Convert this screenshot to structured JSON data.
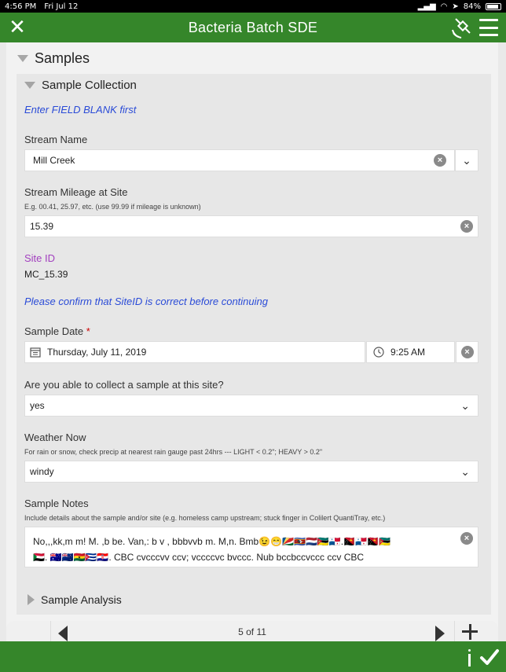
{
  "status": {
    "time": "4:56 PM",
    "date": "Fri Jul 12",
    "battery": "84%"
  },
  "header": {
    "title": "Bacteria Batch SDE"
  },
  "group": {
    "title": "Samples"
  },
  "collection": {
    "title": "Sample Collection",
    "note_field_blank": "Enter FIELD BLANK first",
    "stream_name": {
      "label": "Stream Name",
      "value": "Mill Creek"
    },
    "mileage": {
      "label": "Stream Mileage at Site",
      "hint": "E.g. 00.41, 25.97, etc. (use 99.99 if mileage is unknown)",
      "value": "15.39"
    },
    "site": {
      "label": "Site ID",
      "value": "MC_15.39"
    },
    "note_confirm": "Please confirm that SiteID is correct before continuing",
    "sample_date": {
      "label": "Sample Date",
      "required_mark": "*",
      "date": "Thursday, July 11, 2019",
      "time": "9:25 AM"
    },
    "able": {
      "label": "Are you able to collect a sample at this site?",
      "value": "yes"
    },
    "weather": {
      "label": "Weather Now",
      "hint": "For rain or snow, check precip at nearest rain gauge past 24hrs --- LIGHT < 0.2\"; HEAVY > 0.2\"",
      "value": "windy"
    },
    "notes": {
      "label": "Sample Notes",
      "hint": "Include details about the sample and/or site (e.g. homeless camp upstream; stuck finger in Colilert QuantiTray, etc.)",
      "line1": "No,,,kk,m m! M. ,b be. Van,: b  v ,  bbbvvb m. M,n. Bmb😉😁🇸🇨🇸🇿🇳🇱🇲🇿🇵🇦.🇵🇬🇵🇦🇵🇬🇲🇿",
      "line2": "🇸🇩. 🇦🇺🇳🇿🇬🇭🇨🇺🇭🇷. CBC cvcccvv ccv; vccccvc bvccc. Nub bccbccvccc ccv CBC"
    }
  },
  "analysis": {
    "title": "Sample Analysis"
  },
  "pager": {
    "label": "5 of 11"
  },
  "icons": {
    "close": "close-icon",
    "satellite": "satellite-icon",
    "menu": "menu-icon",
    "calendar": "calendar-icon",
    "clock": "clock-icon",
    "submit": "checkmark-icon",
    "info": "info-icon"
  },
  "colors": {
    "accent": "#35862a",
    "link_blue": "#2a4bd7",
    "site_id_purple": "#a23fbf"
  }
}
